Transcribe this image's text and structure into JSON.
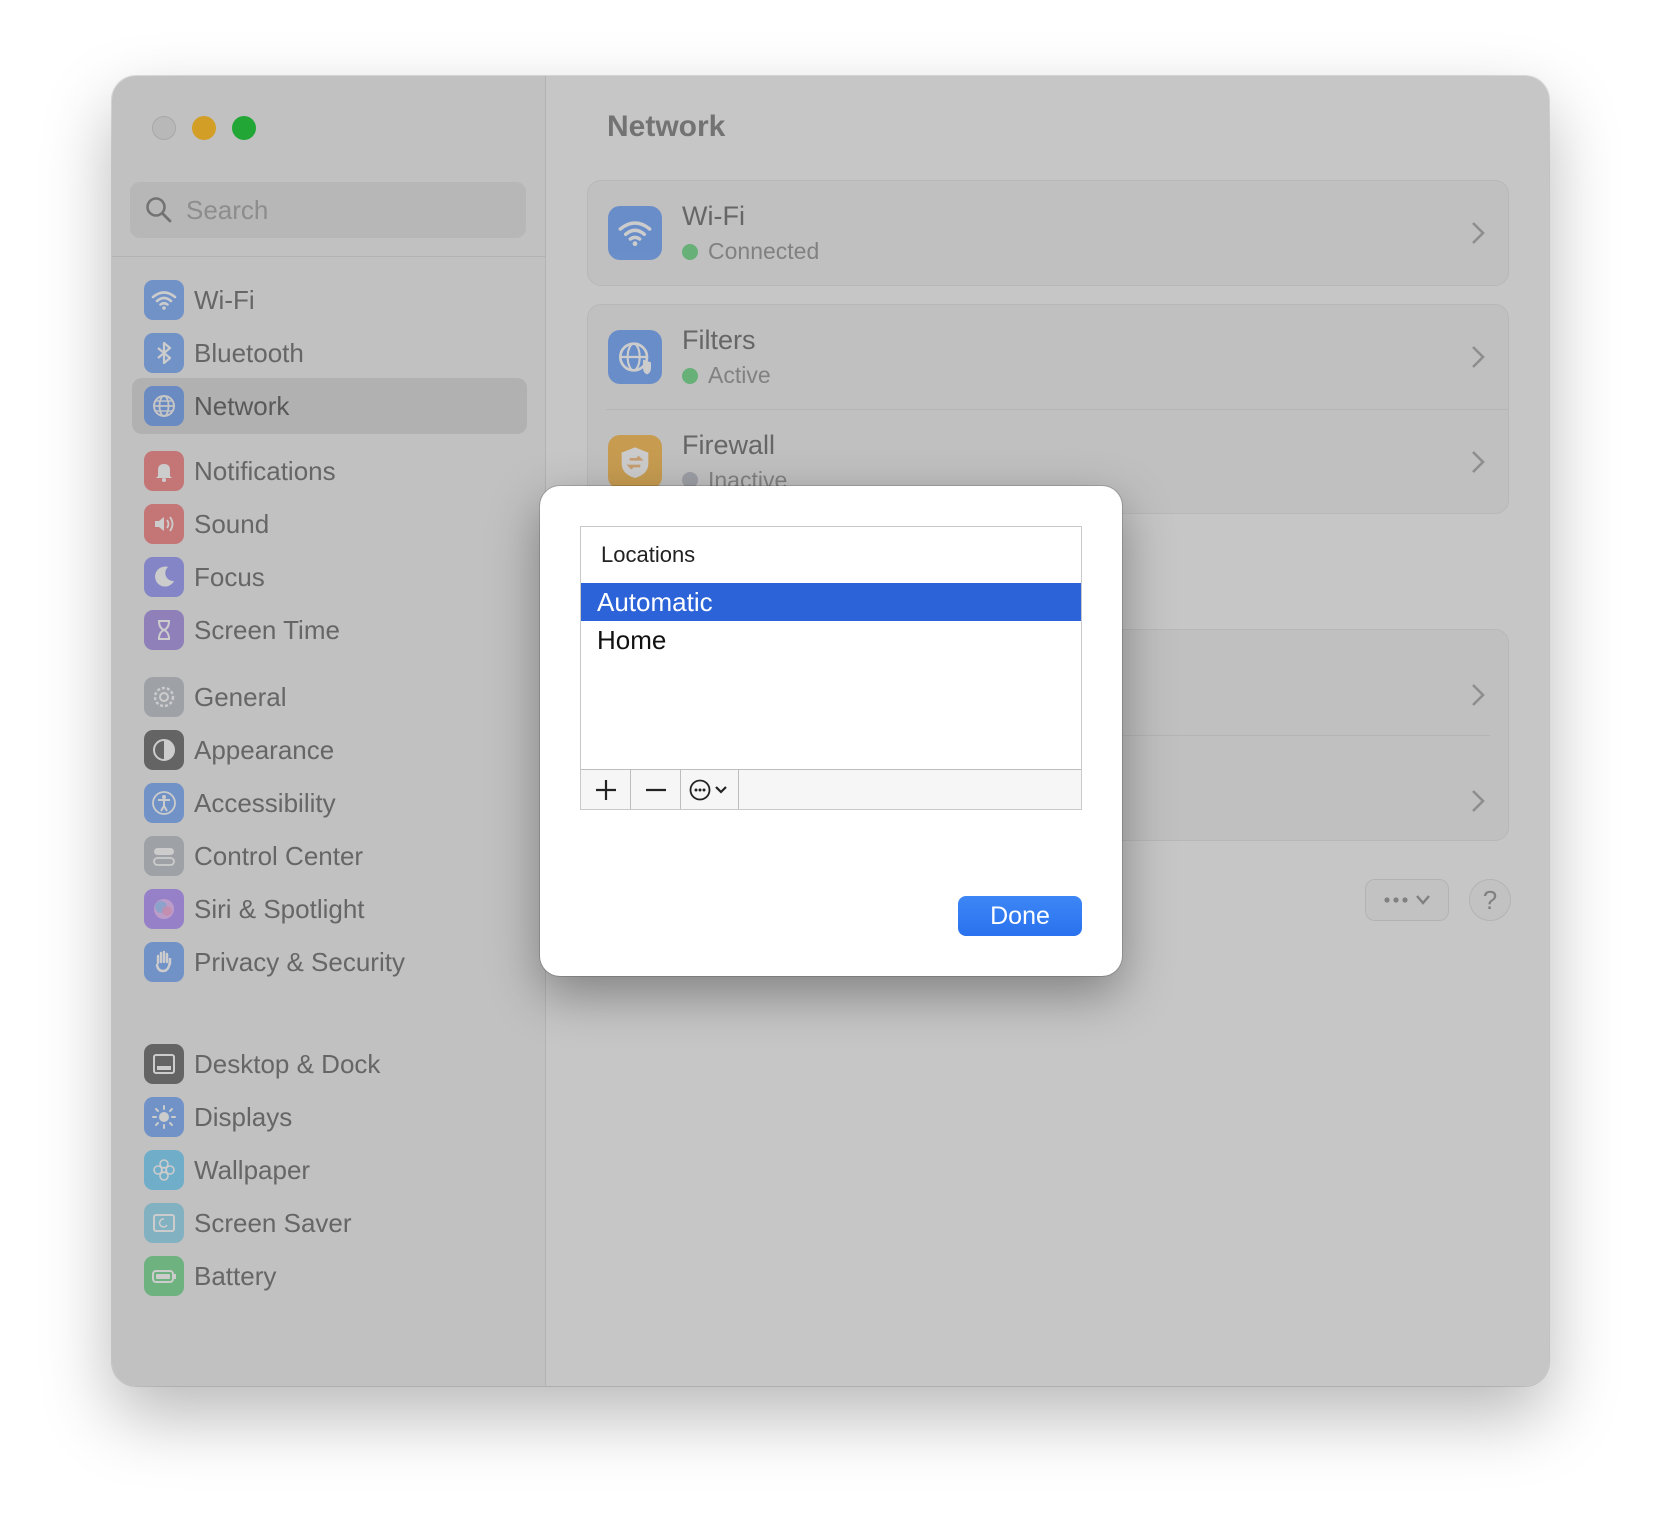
{
  "window": {
    "title": "Network"
  },
  "search": {
    "placeholder": "Search"
  },
  "sidebar": {
    "groups": [
      [
        {
          "label": "Wi-Fi",
          "icon": "wifi-icon",
          "color": "#3b82f6"
        },
        {
          "label": "Bluetooth",
          "icon": "bluetooth-icon",
          "color": "#3b82f6"
        },
        {
          "label": "Network",
          "icon": "globe-icon",
          "color": "#3b82f6",
          "selected": true
        }
      ],
      [
        {
          "label": "Notifications",
          "icon": "bell-icon",
          "color": "#ef4444"
        },
        {
          "label": "Sound",
          "icon": "speaker-icon",
          "color": "#ef4444"
        },
        {
          "label": "Focus",
          "icon": "moon-icon",
          "color": "#6366f1"
        },
        {
          "label": "Screen Time",
          "icon": "hourglass-icon",
          "color": "#7c5cd6"
        }
      ],
      [
        {
          "label": "General",
          "icon": "gear-icon",
          "color": "#9ca3af"
        },
        {
          "label": "Appearance",
          "icon": "appearance-icon",
          "color": "#1f1f1f"
        },
        {
          "label": "Accessibility",
          "icon": "accessibility-icon",
          "color": "#3b82f6"
        },
        {
          "label": "Control Center",
          "icon": "toggles-icon",
          "color": "#9ca3af"
        },
        {
          "label": "Siri & Spotlight",
          "icon": "siri-icon",
          "color": "#8b5cf6"
        },
        {
          "label": "Privacy & Security",
          "icon": "hand-icon",
          "color": "#3b82f6"
        }
      ],
      [
        {
          "label": "Desktop & Dock",
          "icon": "dock-icon",
          "color": "#1f1f1f"
        },
        {
          "label": "Displays",
          "icon": "sun-icon",
          "color": "#3b82f6"
        },
        {
          "label": "Wallpaper",
          "icon": "flower-icon",
          "color": "#38bdf8"
        },
        {
          "label": "Screen Saver",
          "icon": "screensaver-icon",
          "color": "#5ec8e6"
        },
        {
          "label": "Battery",
          "icon": "battery-icon",
          "color": "#34c759"
        }
      ]
    ]
  },
  "main": {
    "rows": [
      {
        "title": "Wi-Fi",
        "status": "Connected",
        "status_color": "#34c759",
        "icon": "wifi-icon",
        "color": "#3b82f6"
      },
      {
        "title": "Filters",
        "status": "Active",
        "status_color": "#34c759",
        "icon": "globe-shield-icon",
        "color": "#3b82f6"
      },
      {
        "title": "Firewall",
        "status": "Inactive",
        "status_color": "#9ca3af",
        "icon": "firewall-icon",
        "color": "#f59e0b"
      }
    ]
  },
  "dialog": {
    "header": "Locations",
    "items": [
      "Automatic",
      "Home"
    ],
    "selected": "Automatic",
    "done_label": "Done"
  },
  "colors": {
    "accent": "#2c63d8",
    "done_button": "#3479f2"
  }
}
